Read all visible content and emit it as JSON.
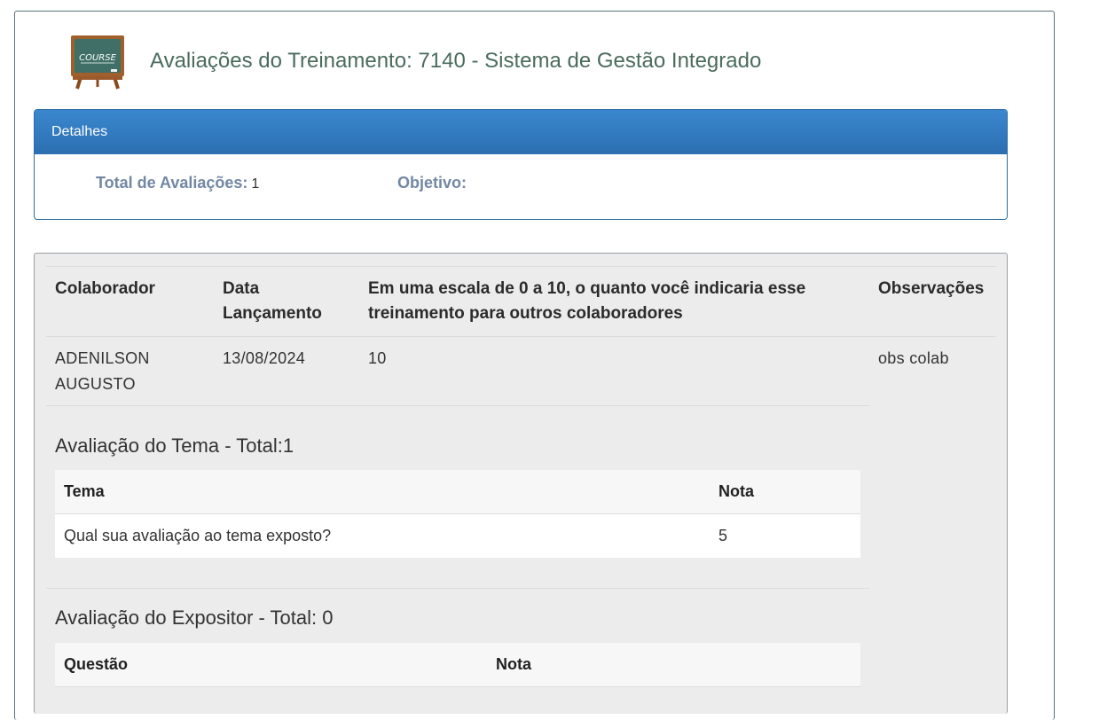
{
  "page": {
    "title": "Avaliações do Treinamento: 7140 - Sistema de Gestão Integrado",
    "icon": "course-chalkboard-icon",
    "icon_text": "COURSE"
  },
  "details": {
    "heading": "Detalhes",
    "total_label": "Total de Avaliações:",
    "total_value": "1",
    "objective_label": "Objetivo:",
    "objective_value": ""
  },
  "evaluations": {
    "columns": {
      "collaborator": "Colaborador",
      "date": "Data Lançamento",
      "scale_question": "Em uma escala de 0 a 10, o quanto você indicaria esse treinamento para outros colaboradores",
      "observations": "Observações"
    },
    "rows": [
      {
        "collaborator": "ADENILSON AUGUSTO",
        "date": "13/08/2024",
        "score": "10",
        "observations": "obs colab"
      }
    ]
  },
  "theme_eval": {
    "title": "Avaliação do Tema - Total:1",
    "columns": {
      "topic": "Tema",
      "grade": "Nota"
    },
    "rows": [
      {
        "topic": "Qual sua avaliação ao tema exposto?",
        "grade": "5"
      }
    ]
  },
  "speaker_eval": {
    "title": "Avaliação do Expositor - Total: 0",
    "columns": {
      "question": "Questão",
      "grade": "Nota"
    },
    "rows": []
  },
  "colors": {
    "title": "#4a6b5d",
    "panel_header": "#337ab7",
    "label": "#7387a4",
    "panel_bg": "#ececec"
  }
}
